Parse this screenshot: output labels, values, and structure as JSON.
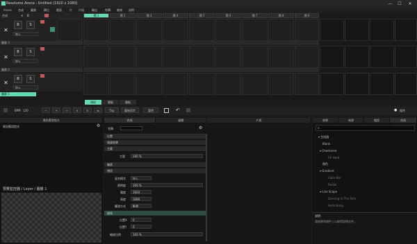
{
  "app": {
    "title": "Resolume Arena - Untitled (1920 x 1080)"
  },
  "window": {
    "minimize": "—",
    "maximize": "☐",
    "close": "✕"
  },
  "menu": [
    "Arena",
    "合成",
    "圖層",
    "欄位",
    "層面",
    "片",
    "片段",
    "輸出",
    "剪輯",
    "檢視",
    "說明"
  ],
  "clip_header": {
    "name_label": "合成",
    "x": "✕",
    "b": "B"
  },
  "columns": [
    "欄 1",
    "欄 2",
    "欄 3",
    "欄 4",
    "欄 5",
    "欄 6",
    "欄 7",
    "欄 8",
    "欄 9",
    "欄 10"
  ],
  "layers": [
    {
      "name": "圖層 3",
      "x": "✕",
      "b": "B",
      "s": "S",
      "blend": "加入"
    },
    {
      "name": "圖層 2",
      "x": "✕",
      "b": "B",
      "s": "S",
      "blend": "加入"
    },
    {
      "name": "圖層 1",
      "x": "✕",
      "b": "B",
      "s": "S",
      "blend": "加入"
    }
  ],
  "decks": [
    "預設",
    "層板",
    "層板"
  ],
  "transport": {
    "bpm_label": "BPM",
    "bpm_value": "120",
    "btns": [
      "—",
      "+",
      "÷",
      "×",
      "↻",
      "⇆"
    ],
    "tap": "Tap",
    "resync": "重新同步",
    "pause": "暫停"
  },
  "top_right": {
    "dot": "●",
    "label": "組合"
  },
  "left_panel": {
    "title": "資訊應用程式",
    "sub": "資訊應用程式",
    "preview": "預覽監控器 / Layer / 圖層 1"
  },
  "center_panel": {
    "tabs": [
      "合成",
      "圖層",
      "片段"
    ],
    "name_label": "名稱",
    "sections": {
      "transition": "位置",
      "crossfade": "過渡效果",
      "master": "主要",
      "master_val": "100 %",
      "master_label": "主要"
    },
    "dashboard": "儀表",
    "video": "視訊",
    "props": [
      {
        "label": "混合模式",
        "value": "加入"
      },
      {
        "label": "透明度",
        "value": "100 %"
      },
      {
        "label": "寬度",
        "value": "1920"
      },
      {
        "label": "高度",
        "value": "1080"
      },
      {
        "label": "觸發方式",
        "value": "點選"
      }
    ],
    "transform": "變換",
    "transform_props": [
      {
        "label": "位置X",
        "value": "0"
      },
      {
        "label": "位置Y",
        "value": "0"
      }
    ],
    "scale_label": "縮放比例",
    "scale_val": "100 %"
  },
  "right_panel": {
    "tabs": [
      "效果",
      "來源",
      "檔案",
      "合成"
    ],
    "tree": [
      {
        "text": "▾ 生成器",
        "sub": false
      },
      {
        "text": "Blank",
        "sub": false
      },
      {
        "text": "▾ Checkered",
        "sub": false
      },
      {
        "text": "Fill Hard",
        "sub": true
      },
      {
        "text": "顏色",
        "sub": false
      },
      {
        "text": "▾ Gradient",
        "sub": false
      },
      {
        "text": "Color Bar",
        "sub": true
      },
      {
        "text": "Radial",
        "sub": true
      },
      {
        "text": "▾ Line Scape",
        "sub": false
      },
      {
        "text": "Dancing in The Rain",
        "sub": true
      },
      {
        "text": "Hello Bung",
        "sub": true
      }
    ],
    "desc_title": "說明",
    "desc_text": "滑鼠移到物件上以取得說明文件。"
  },
  "colors": {
    "accent": "#66d9b0",
    "bg": "#1a1a1a"
  }
}
